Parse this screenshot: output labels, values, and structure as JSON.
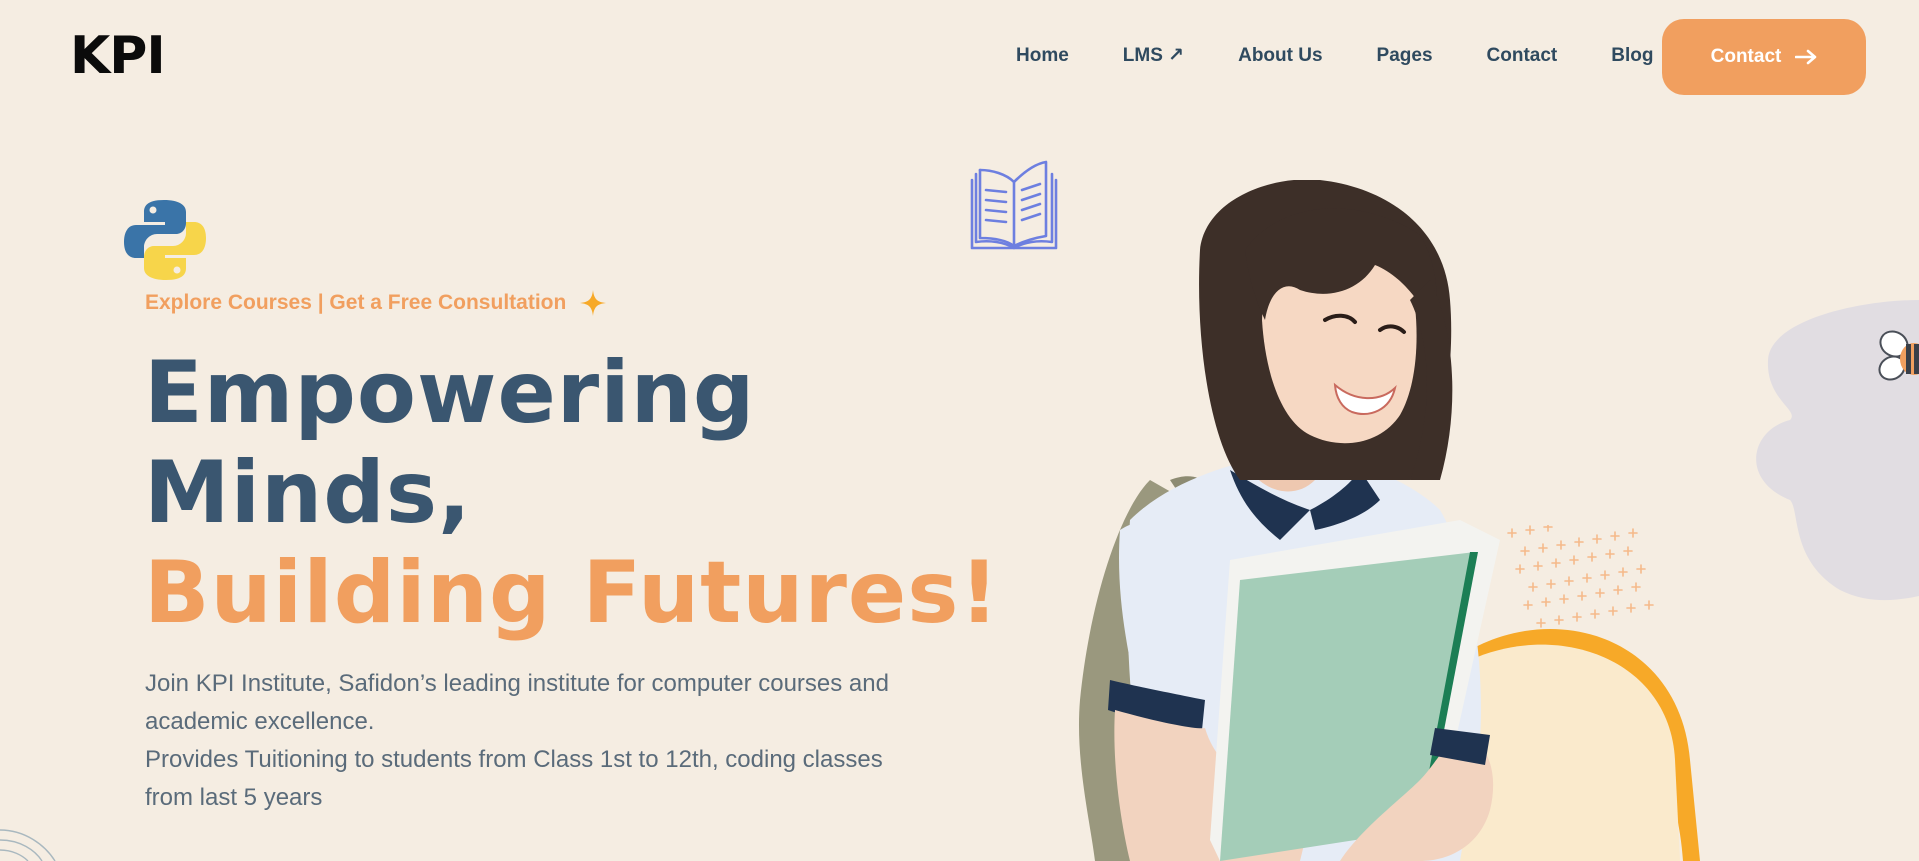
{
  "header": {
    "logo": "KPI",
    "nav": [
      {
        "label": "Home"
      },
      {
        "label": "LMS ↗"
      },
      {
        "label": "About Us"
      },
      {
        "label": "Pages"
      },
      {
        "label": "Contact"
      },
      {
        "label": "Blog"
      }
    ],
    "cta_label": "Contact"
  },
  "hero": {
    "tagline": "Explore Courses | Get a Free Consultation",
    "headline_line1": "Empowering",
    "headline_line2": "Minds,",
    "headline_line3": "Building Futures!",
    "description_1": "Join KPI Institute, Safidon’s leading institute for computer courses and academic excellence.",
    "description_2": "Provides Tuitioning to students from Class 1st to 12th, coding classes from last 5 years"
  },
  "colors": {
    "background": "#f5ede2",
    "accent": "#f19f5f",
    "heading": "#3a5670",
    "text": "#5a6b7a",
    "yellow": "#f7a928"
  },
  "icons": [
    "python-logo-icon",
    "sparkle-icon",
    "open-book-icon",
    "arrow-right-icon",
    "bee-icon"
  ]
}
